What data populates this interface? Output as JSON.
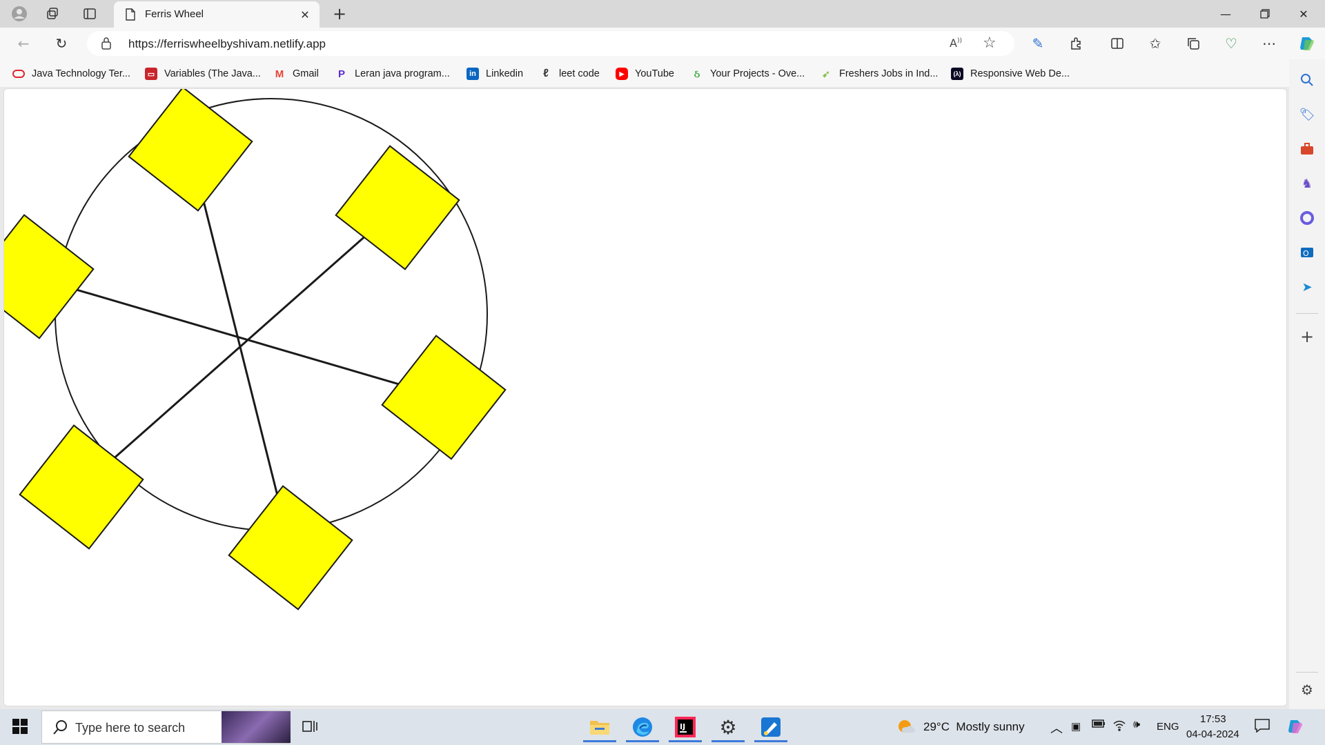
{
  "tab": {
    "title": "Ferris Wheel"
  },
  "address": {
    "url": "https://ferriswheelbyshivam.netlify.app"
  },
  "bookmarks": [
    {
      "label": "Java Technology Ter...",
      "icon": "oracle-icon",
      "color": "#e0242a"
    },
    {
      "label": "Variables (The Java...",
      "icon": "oracle-book-icon",
      "color": "#c9252b"
    },
    {
      "label": "Gmail",
      "icon": "gmail-icon",
      "color": "#ea4335"
    },
    {
      "label": "Leran java program...",
      "icon": "p-logo-icon",
      "color": "#5b2bd6"
    },
    {
      "label": "Linkedin",
      "icon": "linkedin-icon",
      "color": "#0a66c2"
    },
    {
      "label": "leet code",
      "icon": "leetcode-icon",
      "color": "#f89f1b"
    },
    {
      "label": "YouTube",
      "icon": "youtube-icon",
      "color": "#ff0000"
    },
    {
      "label": "Your Projects - Ove...",
      "icon": "project-icon",
      "color": "#4caf50"
    },
    {
      "label": "Freshers Jobs in Ind...",
      "icon": "bird-icon",
      "color": "#8bc34a"
    },
    {
      "label": "Responsive Web De...",
      "icon": "fcc-icon",
      "color": "#0a0a23"
    }
  ],
  "scene": {
    "wheel_stroke": "#1a1a1a",
    "cabin_color": "#ffff00",
    "cabin_count": 6
  },
  "taskbar": {
    "search_placeholder": "Type here to search",
    "weather": "29°C  Mostly sunny",
    "language": "ENG",
    "time": "17:53",
    "date": "04-04-2024"
  }
}
